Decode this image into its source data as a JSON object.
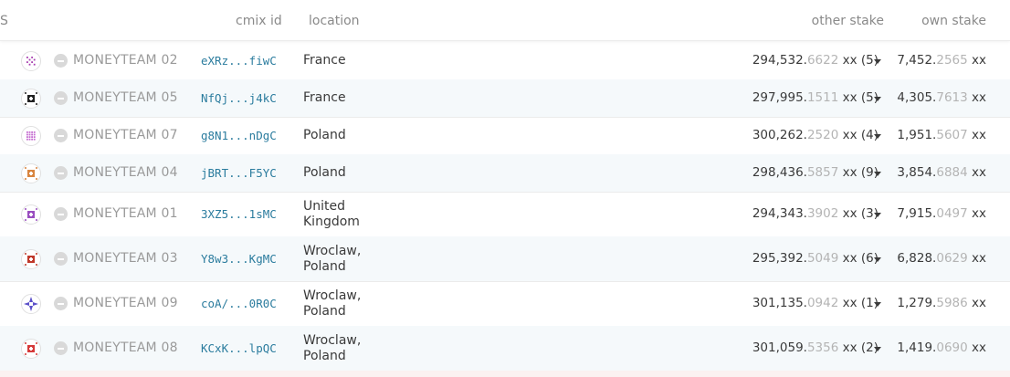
{
  "header": {
    "col_s": "S",
    "col_cmix": "cmix id",
    "col_location": "location",
    "col_other_stake": "other stake",
    "col_own_stake": "own stake"
  },
  "rows": [
    {
      "name": "MONEYTEAM  02",
      "cmix": "eXRz...fiwC",
      "loc1": "France",
      "loc2": "",
      "other_int": "294,532.",
      "other_dec": "6622",
      "other_unit": " xx (5)",
      "own_int": "7,452.",
      "own_dec": "2565",
      "own_unit": " xx",
      "icon": "identicon-purple-lattice",
      "icon_color": "#a83fb0"
    },
    {
      "name": "MONEYTEAM  05",
      "cmix": "NfQj...j4kC",
      "loc1": "France",
      "loc2": "",
      "other_int": "297,995.",
      "other_dec": "1511",
      "other_unit": " xx (5)",
      "own_int": "4,305.",
      "own_dec": "7613",
      "own_unit": " xx",
      "icon": "identicon-black-square",
      "icon_color": "#222222"
    },
    {
      "name": "MONEYTEAM  07",
      "cmix": "g8N1...nDgC",
      "loc1": "Poland",
      "loc2": "",
      "other_int": "300,262.",
      "other_dec": "2520",
      "other_unit": " xx (4)",
      "own_int": "1,951.",
      "own_dec": "5607",
      "own_unit": " xx",
      "icon": "identicon-pink-grid",
      "icon_color": "#c46bd0"
    },
    {
      "name": "MONEYTEAM  04",
      "cmix": "jBRT...F5YC",
      "loc1": "Poland",
      "loc2": "",
      "other_int": "298,436.",
      "other_dec": "5857",
      "other_unit": " xx (9)",
      "own_int": "3,854.",
      "own_dec": "6884",
      "own_unit": " xx",
      "icon": "identicon-orange-square",
      "icon_color": "#d9853f"
    },
    {
      "name": "MONEYTEAM  01",
      "cmix": "3XZ5...1sMC",
      "loc1": "United",
      "loc2": "Kingdom",
      "other_int": "294,343.",
      "other_dec": "3902",
      "other_unit": " xx (3)",
      "own_int": "7,915.",
      "own_dec": "0497",
      "own_unit": " xx",
      "icon": "identicon-purple-dots",
      "icon_color": "#9a4fc0"
    },
    {
      "name": "MONEYTEAM  03",
      "cmix": "Y8w3...KgMC",
      "loc1": "Wroclaw,",
      "loc2": "Poland",
      "other_int": "295,392.",
      "other_dec": "5049",
      "other_unit": " xx (6)",
      "own_int": "6,828.",
      "own_dec": "0629",
      "own_unit": " xx",
      "icon": "identicon-red-black",
      "icon_color": "#c0392b"
    },
    {
      "name": "MONEYTEAM  09",
      "cmix": "coA/...0R0C",
      "loc1": "Wroclaw,",
      "loc2": "Poland",
      "other_int": "301,135.",
      "other_dec": "0942",
      "other_unit": " xx (1)",
      "own_int": "1,279.",
      "own_dec": "5986",
      "own_unit": " xx",
      "icon": "identicon-blue-star",
      "icon_color": "#5a4fc9"
    },
    {
      "name": "MONEYTEAM  08",
      "cmix": "KCxK...lpQC",
      "loc1": "Wroclaw,",
      "loc2": "Poland",
      "other_int": "301,059.",
      "other_dec": "5356",
      "other_unit": " xx (2)",
      "own_int": "1,419.",
      "own_dec": "0690",
      "own_unit": " xx",
      "icon": "identicon-red-cross",
      "icon_color": "#d63a3a"
    }
  ]
}
